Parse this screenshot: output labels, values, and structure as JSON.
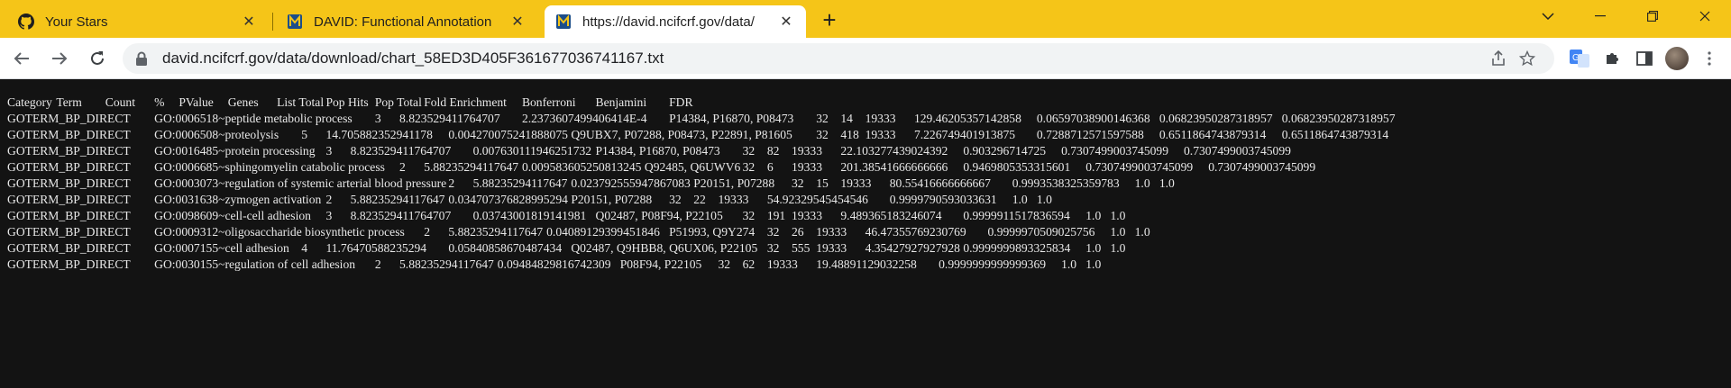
{
  "browser": {
    "tabs": [
      {
        "title": "Your Stars",
        "icon": "github-icon",
        "active": false
      },
      {
        "title": "DAVID: Functional Annotation",
        "icon": "david-icon",
        "active": false
      },
      {
        "title": "https://david.ncifcrf.gov/data/",
        "icon": "david-icon",
        "active": true
      }
    ],
    "url": "david.ncifcrf.gov/data/download/chart_58ED3D405F361677036741167.txt"
  },
  "document": {
    "text": "Category\tTerm\tCount\t%\tPValue\tGenes\tList Total\tPop Hits\tPop Total\tFold Enrichment\tBonferroni\tBenjamini\tFDR\nGOTERM_BP_DIRECT\tGO:0006518~peptide metabolic process\t3\t8.823529411764707\t2.2373607499406414E-4\tP14384, P16870, P08473\t32\t14\t19333\t129.46205357142858\t0.06597038900146368\t0.06823950287318957\t0.06823950287318957\nGOTERM_BP_DIRECT\tGO:0006508~proteolysis\t5\t14.705882352941178\t0.004270075241888075\tQ9UBX7, P07288, P08473, P22891, P81605\t32\t418\t19333\t7.226749401913875\t0.7288712571597588\t0.6511864743879314\t0.6511864743879314\nGOTERM_BP_DIRECT\tGO:0016485~protein processing\t3\t8.823529411764707\t0.007630111946251732\tP14384, P16870, P08473\t32\t82\t19333\t22.103277439024392\t0.903296714725\t0.7307499003745099\t0.7307499003745099\nGOTERM_BP_DIRECT\tGO:0006685~sphingomyelin catabolic process\t2\t5.88235294117647\t0.009583605250813245\tQ92485, Q6UWV6\t32\t6\t19333\t201.38541666666666\t0.9469805353315601\t0.7307499003745099\t0.7307499003745099\nGOTERM_BP_DIRECT\tGO:0003073~regulation of systemic arterial blood pressure\t2\t5.88235294117647\t0.023792555947867083\tP20151, P07288\t32\t15\t19333\t80.55416666666667\t0.9993538325359783\t1.0\t1.0\nGOTERM_BP_DIRECT\tGO:0031638~zymogen activation\t2\t5.88235294117647\t0.034707376828995294\tP20151, P07288\t32\t22\t19333\t54.92329545454546\t0.9999790593033631\t1.0\t1.0\nGOTERM_BP_DIRECT\tGO:0098609~cell-cell adhesion\t3\t8.823529411764707\t0.03743001819141981\tQ02487, P08F94, P22105\t32\t191\t19333\t9.489365183246074\t0.9999911517836594\t1.0\t1.0\nGOTERM_BP_DIRECT\tGO:0009312~oligosaccharide biosynthetic process\t2\t5.88235294117647\t0.04089129399451846\tP51993, Q9Y274\t32\t26\t19333\t46.47355769230769\t0.9999970509025756\t1.0\t1.0\nGOTERM_BP_DIRECT\tGO:0007155~cell adhesion\t4\t11.76470588235294\t0.05840858670487434\tQ02487, Q9HBB8, Q6UX06, P22105\t32\t555\t19333\t4.35427927927928\t0.9999999893325834\t1.0\t1.0\nGOTERM_BP_DIRECT\tGO:0030155~regulation of cell adhesion\t2\t5.88235294117647\t0.09484829816742309\tP08F94, P22105\t32\t62\t19333\t19.48891129032258\t0.9999999999999369\t1.0\t1.0"
  }
}
